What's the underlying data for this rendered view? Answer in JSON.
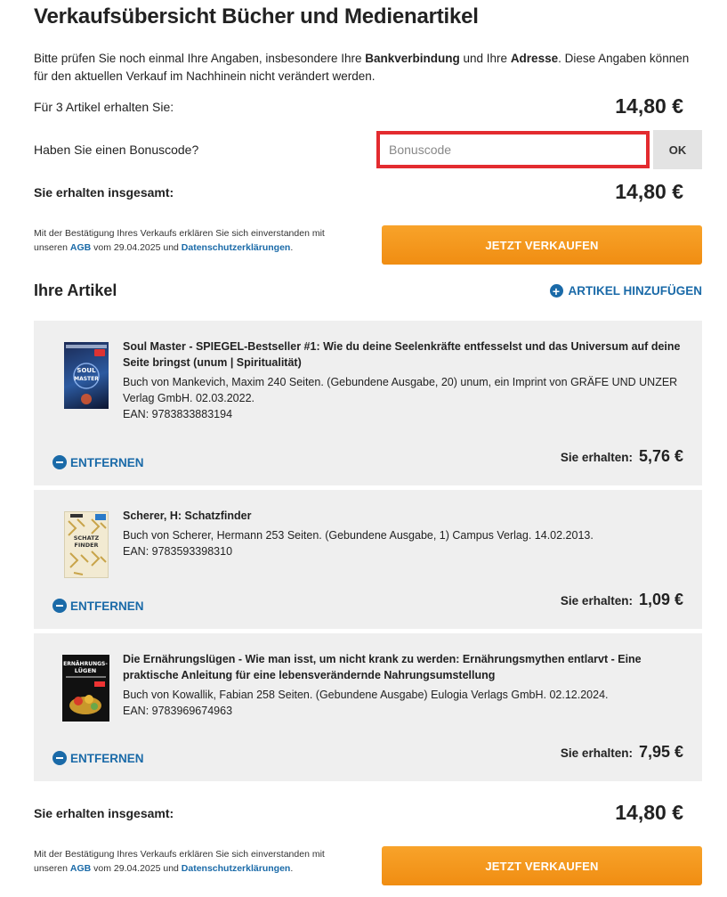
{
  "page_title": "Verkaufsübersicht Bücher und Medienartikel",
  "intro": {
    "part1": "Bitte prüfen Sie noch einmal Ihre Angaben, insbesondere Ihre ",
    "bold1": "Bankverbindung",
    "part2": " und Ihre ",
    "bold2": "Adresse",
    "part3": ". Diese Angaben können für den aktuellen Verkauf im Nachhinein nicht verändert werden."
  },
  "summary": {
    "items_label": "Für 3 Artikel erhalten Sie:",
    "items_amount": "14,80 €",
    "bonus_label": "Haben Sie einen Bonuscode?",
    "bonus_placeholder": "Bonuscode",
    "bonus_value": "",
    "ok_label": "OK",
    "total_label": "Sie erhalten insgesamt:",
    "total_amount": "14,80 €"
  },
  "legal": {
    "part1": "Mit der Bestätigung Ihres Verkaufs erklären Sie sich einverstanden mit unseren ",
    "agb": "AGB",
    "part2": " vom 29.04.2025 und ",
    "privacy": "Datenschutzerklärungen",
    "part3": "."
  },
  "sell_button": "JETZT VERKAUFEN",
  "articles_heading": "Ihre Artikel",
  "add_article": "ARTIKEL HINZUFÜGEN",
  "remove_label": "ENTFERNEN",
  "receive_label": "Sie erhalten:",
  "articles": [
    {
      "title": "Soul Master - SPIEGEL-Bestseller #1: Wie du deine Seelenkräfte entfesselst und das Universum auf deine Seite bringst (unum | Spiritualität)",
      "details": "Buch von Mankevich, Maxim 240 Seiten. (Gebundene Ausgabe, 20) unum, ein Imprint von GRÄFE UND UNZER Verlag GmbH. 02.03.2022.",
      "ean": "EAN: 9783833883194",
      "price": "5,76 €",
      "cover_text": "SOUL MASTER"
    },
    {
      "title": "Scherer, H: Schatzfinder",
      "details": "Buch von Scherer, Hermann 253 Seiten. (Gebundene Ausgabe, 1) Campus Verlag. 14.02.2013.",
      "ean": "EAN: 9783593398310",
      "price": "1,09 €",
      "cover_text": "SCHATZ FINDER"
    },
    {
      "title": "Die Ernährungslügen - Wie man isst, um nicht krank zu werden: Ernährungsmythen entlarvt - Eine praktische Anleitung für eine lebensverändernde Nahrungsumstellung",
      "details": "Buch von Kowallik, Fabian 258 Seiten. (Gebundene Ausgabe) Eulogia Verlags GmbH. 02.12.2024.",
      "ean": "EAN: 9783969674963",
      "price": "7,95 €",
      "cover_text": "ERNÄHRUNGS-LÜGEN"
    }
  ],
  "bottom": {
    "total_label": "Sie erhalten insgesamt:",
    "total_amount": "14,80 €"
  }
}
